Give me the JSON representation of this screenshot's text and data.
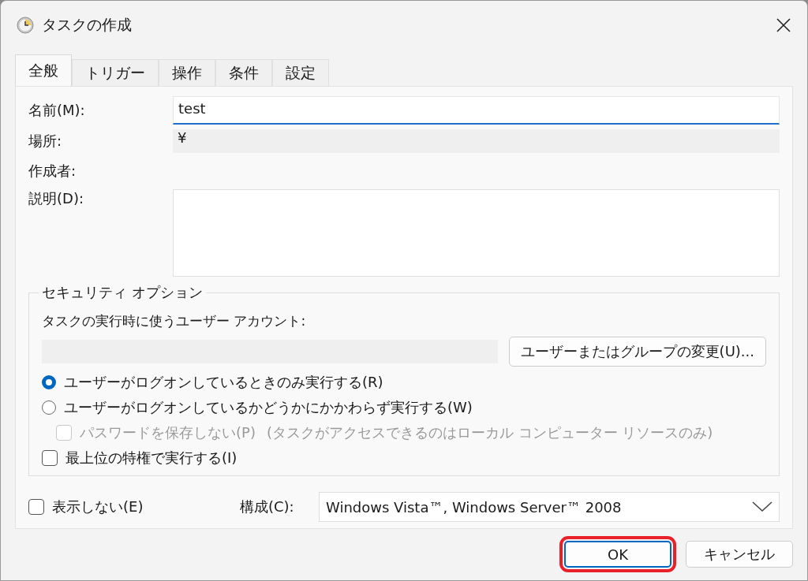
{
  "window": {
    "title": "タスクの作成"
  },
  "tabs": [
    {
      "label": "全般",
      "selected": true
    },
    {
      "label": "トリガー",
      "selected": false
    },
    {
      "label": "操作",
      "selected": false
    },
    {
      "label": "条件",
      "selected": false
    },
    {
      "label": "設定",
      "selected": false
    }
  ],
  "general": {
    "name_label": "名前(M):",
    "name_value": "test",
    "location_label": "場所:",
    "location_value": "¥",
    "author_label": "作成者:",
    "description_label": "説明(D):"
  },
  "security": {
    "title": "セキュリティ オプション",
    "account_label": "タスクの実行時に使うユーザー アカウント:",
    "change_user_button": "ユーザーまたはグループの変更(U)...",
    "radios": [
      {
        "label": "ユーザーがログオンしているときのみ実行する(R)",
        "selected": true
      },
      {
        "label": "ユーザーがログオンしているかどうかにかかわらず実行する(W)",
        "selected": false
      }
    ],
    "no_password": {
      "label": "パスワードを保存しない(P)",
      "note": "(タスクがアクセスできるのはローカル コンピューター リソースのみ)",
      "checked": false,
      "disabled": true
    },
    "highest_privileges": {
      "label": "最上位の特権で実行する(I)",
      "checked": false,
      "disabled": false
    }
  },
  "hidden": {
    "label": "表示しない(E)",
    "checked": false,
    "disabled": false
  },
  "configure": {
    "label": "構成(C):",
    "value": "Windows Vista™, Windows Server™ 2008"
  },
  "buttons": [
    {
      "label": "OK",
      "highlighted": true
    },
    {
      "label": "キャンセル",
      "highlighted": false
    }
  ]
}
